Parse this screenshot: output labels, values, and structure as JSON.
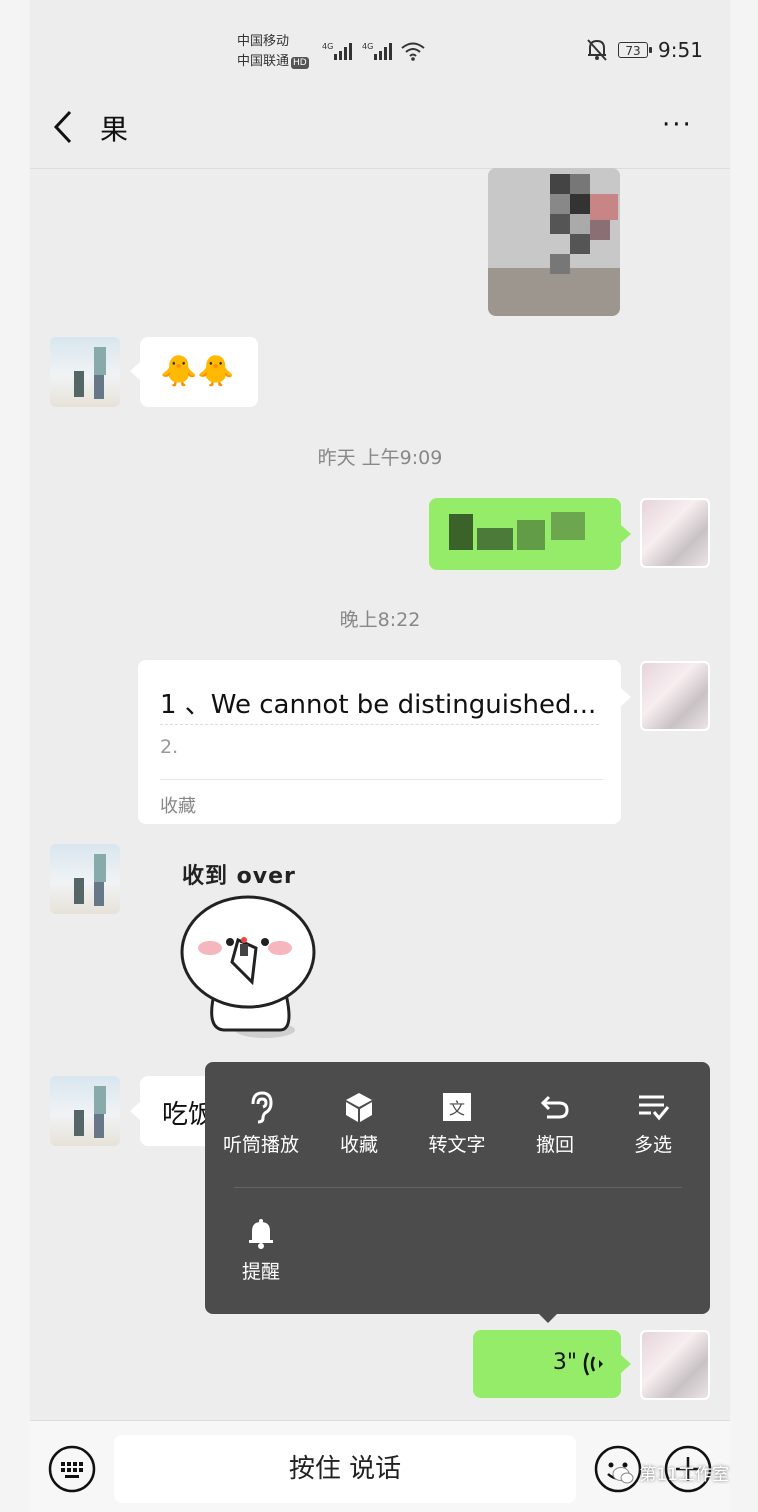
{
  "status_bar": {
    "carrier1": "中国移动",
    "carrier2": "中国联通",
    "hd_badge": "HD",
    "net1": "4G",
    "net2": "4G",
    "battery": "73",
    "time": "9:51"
  },
  "header": {
    "title": "果",
    "more": "···"
  },
  "messages": {
    "them_emoji": "🐥🐥",
    "timestamp1": "昨天 上午9:09",
    "timestamp2": "晚上8:22",
    "card": {
      "title": "1 、We cannot be distinguished...",
      "subtitle": "2.",
      "footer": "收藏"
    },
    "sticker_caption": "收到 over",
    "them_text_partial": "吃饭",
    "voice_duration": "3\""
  },
  "context_menu": {
    "items": [
      {
        "label": "听筒播放",
        "icon": "ear-icon"
      },
      {
        "label": "收藏",
        "icon": "cube-icon"
      },
      {
        "label": "转文字",
        "icon": "text-convert-icon"
      },
      {
        "label": "撤回",
        "icon": "undo-icon"
      },
      {
        "label": "多选",
        "icon": "multi-select-icon"
      },
      {
        "label": "提醒",
        "icon": "bell-icon"
      }
    ]
  },
  "input_bar": {
    "hold_to_talk": "按住 说话"
  },
  "watermark": "第11工作室",
  "colors": {
    "green_bubble": "#95ec69",
    "menu_bg": "#4c4c4c",
    "chat_bg": "#ededed"
  }
}
